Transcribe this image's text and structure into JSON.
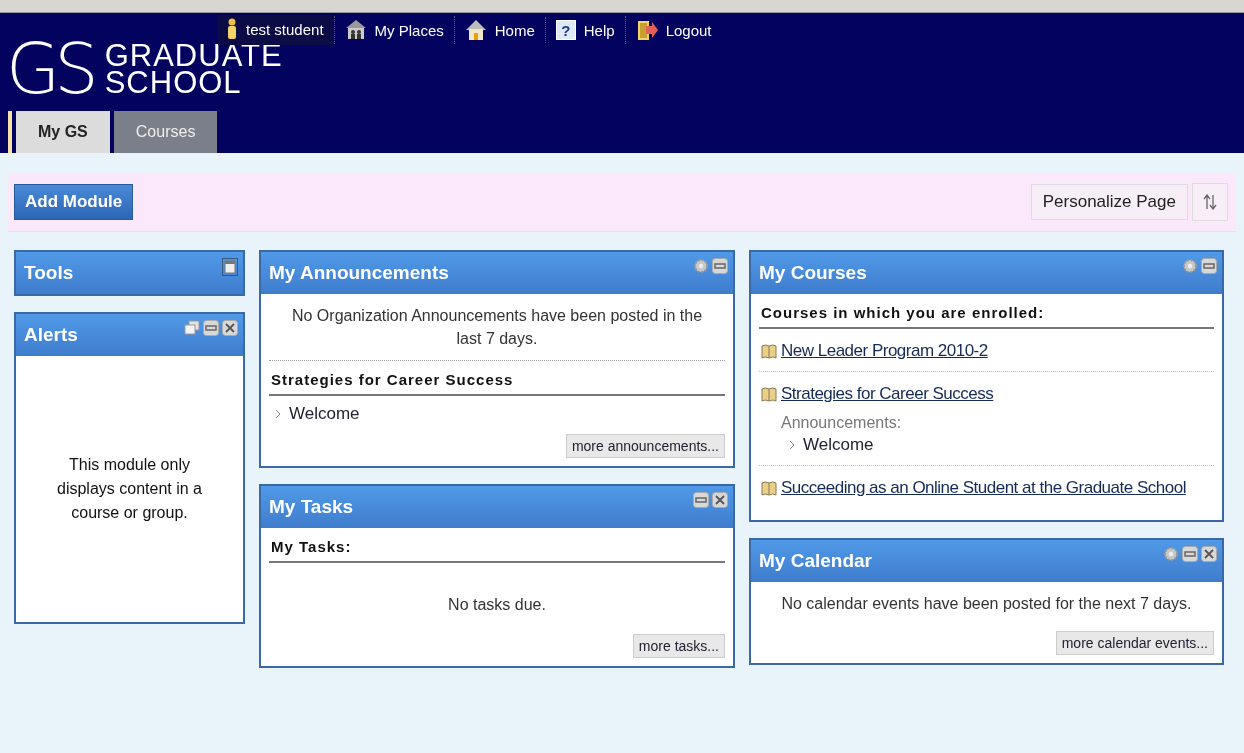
{
  "logo": {
    "mark": "GS",
    "line1": "GRADUATE",
    "line2": "SCHOOL"
  },
  "user": {
    "name": "test student"
  },
  "nav": [
    {
      "label": "My Places",
      "kind": "places"
    },
    {
      "label": "Home",
      "kind": "home"
    },
    {
      "label": "Help",
      "kind": "help",
      "icon": "?"
    },
    {
      "label": "Logout",
      "kind": "logout"
    }
  ],
  "tabs": [
    {
      "label": "My GS",
      "selected": true
    },
    {
      "label": "Courses",
      "selected": false
    }
  ],
  "action_bar": {
    "add": "Add Module",
    "personalize": "Personalize Page"
  },
  "columns": [
    [
      {
        "title": "Tools",
        "collapsed": true,
        "settings": false,
        "closable": false
      },
      {
        "title": "Alerts",
        "collapsed": false,
        "detachable": true,
        "settings": false,
        "closable": true,
        "body": [
          {
            "kind": "notice",
            "text": "This module only displays content in a course or group."
          }
        ]
      }
    ],
    [
      {
        "title": "My Announcements",
        "collapsed": false,
        "settings": true,
        "closable": false,
        "body": [
          {
            "kind": "message",
            "text": "No Organization Announcements have been posted in the last 7 days."
          },
          {
            "kind": "heading",
            "text": "Strategies for Career Success"
          },
          {
            "kind": "item",
            "text": "Welcome"
          },
          {
            "kind": "more",
            "text": "more announcements..."
          }
        ]
      },
      {
        "title": "My Tasks",
        "collapsed": false,
        "settings": false,
        "closable": true,
        "body": [
          {
            "kind": "heading",
            "text": "My Tasks:"
          },
          {
            "kind": "message",
            "text": "No tasks due."
          },
          {
            "kind": "more",
            "text": "more tasks..."
          }
        ]
      }
    ],
    [
      {
        "title": "My Courses",
        "collapsed": false,
        "settings": true,
        "closable": false,
        "body": [
          {
            "kind": "heading",
            "text": "Courses in which you are enrolled:"
          },
          {
            "kind": "course",
            "text": "New Leader Program 2010-2"
          },
          {
            "kind": "course",
            "text": "Strategies for Career Success",
            "label": "Announcements:",
            "items": [
              "Welcome"
            ]
          },
          {
            "kind": "course",
            "text": "Succeeding as an Online Student at the Graduate School"
          }
        ]
      },
      {
        "title": "My Calendar",
        "collapsed": false,
        "settings": true,
        "closable": true,
        "body": [
          {
            "kind": "message",
            "text": "No calendar events have been posted for the next 7 days."
          },
          {
            "kind": "more",
            "text": "more calendar events..."
          }
        ]
      }
    ]
  ]
}
